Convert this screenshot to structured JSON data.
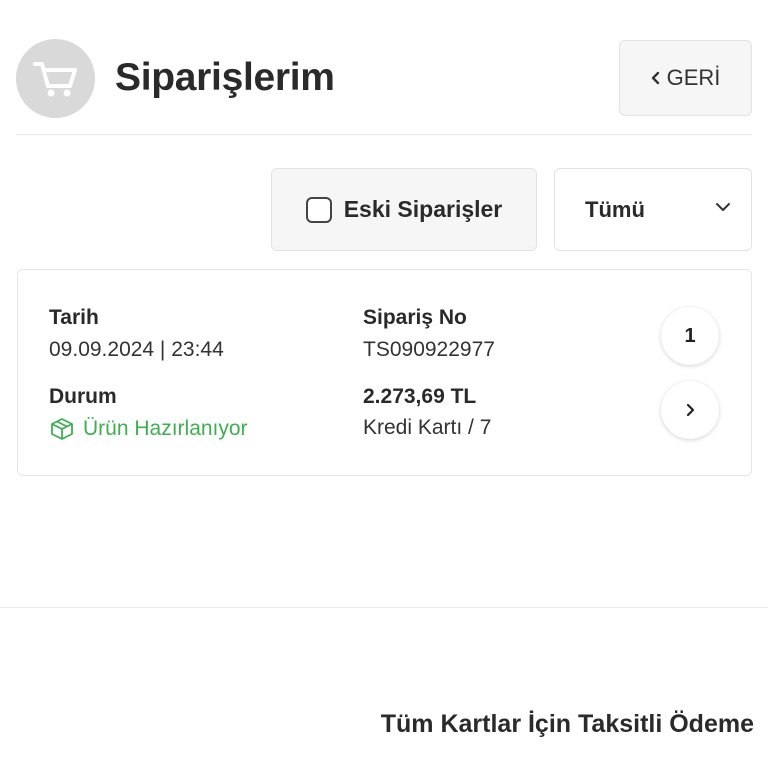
{
  "header": {
    "title": "Siparişlerim",
    "icon": "shopping-cart-icon",
    "back_label": "GERİ"
  },
  "filters": {
    "old_orders_label": "Eski Siparişler",
    "old_orders_checked": false,
    "status_selected": "Tümü"
  },
  "order": {
    "date_label": "Tarih",
    "date_value": "09.09.2024 | 23:44",
    "order_no_label": "Sipariş No",
    "order_no_value": "TS090922977",
    "status_label": "Durum",
    "status_value": "Ürün Hazırlanıyor",
    "status_color": "#3fae52",
    "amount": "2.273,69 TL",
    "payment": "Kredi Kartı / 7",
    "item_count": "1"
  },
  "footer": {
    "installment_text": "Tüm Kartlar İçin Taksitli Ödeme"
  }
}
